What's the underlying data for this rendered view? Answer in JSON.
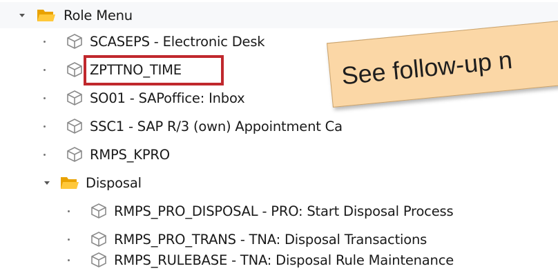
{
  "tree": {
    "root": {
      "label": "Role Menu",
      "icon": "folder-open-icon"
    },
    "items": [
      {
        "label": "SCASEPS - Electronic Desk",
        "icon": "transaction-cube-icon"
      },
      {
        "label": "ZPTTNO_TIME",
        "icon": "transaction-cube-icon"
      },
      {
        "label": "SO01 - SAPoffice: Inbox",
        "icon": "transaction-cube-icon"
      },
      {
        "label": "SSC1 - SAP R/3 (own) Appointment Ca",
        "icon": "transaction-cube-icon"
      },
      {
        "label": "RMPS_KPRO",
        "icon": "transaction-cube-icon"
      }
    ],
    "subfolder": {
      "label": "Disposal",
      "icon": "folder-open-icon",
      "items": [
        {
          "label": "RMPS_PRO_DISPOSAL - PRO: Start Disposal Process",
          "icon": "transaction-cube-icon"
        },
        {
          "label": "RMPS_PRO_TRANS - TNA: Disposal Transactions",
          "icon": "transaction-cube-icon"
        },
        {
          "label": "RMPS_RULEBASE - TNA: Disposal Rule Maintenance",
          "icon": "transaction-cube-icon"
        }
      ]
    }
  },
  "annotation": {
    "sticky_text": "See follow-up n",
    "highlight_color": "#c0282d",
    "sticky_color": "#fbd7a6"
  },
  "colors": {
    "folder": "#f5b400",
    "cube_stroke": "#8a8a8a"
  }
}
